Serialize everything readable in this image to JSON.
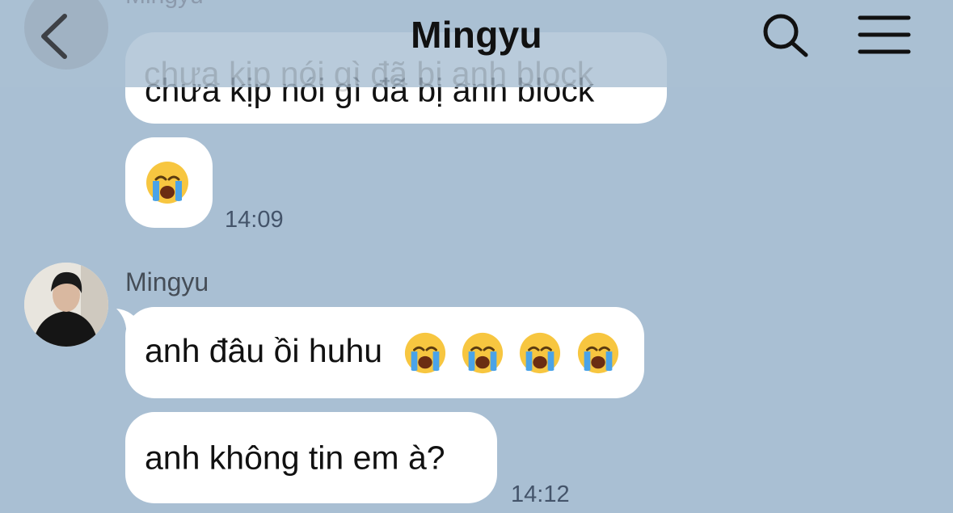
{
  "header": {
    "title": "Mingyu"
  },
  "ghost": {
    "sender": "Mingyu",
    "text": "chưa kịp nói gì đã bị anh block"
  },
  "messages": [
    {
      "text": "chưa kịp nói gì đã bị anh block"
    },
    {
      "emoji": "loudly-crying-face-icon",
      "time": "14:09"
    },
    {
      "sender": "Mingyu",
      "text": "anh đâu ồi huhu",
      "emoji_count": 4
    },
    {
      "text": "anh không tin em à?",
      "time": "14:12"
    }
  ],
  "colors": {
    "background": "#a9bfd3",
    "bubble": "#ffffff",
    "timestamp": "#44546a"
  }
}
